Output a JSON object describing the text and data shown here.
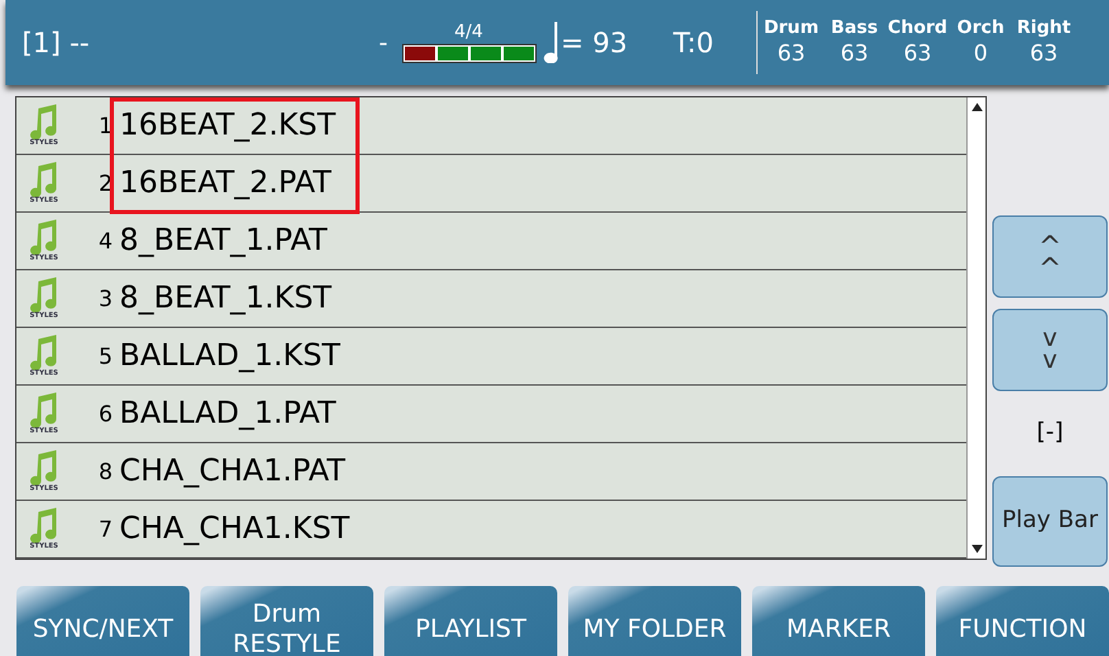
{
  "header": {
    "slot": "[1] --",
    "dash": "-",
    "time_signature": "4/4",
    "beats": [
      {
        "selected": true
      },
      {
        "selected": false
      },
      {
        "selected": false
      },
      {
        "selected": false
      }
    ],
    "tempo": "= 93",
    "transpose": "T:0",
    "volumes": [
      {
        "label": "Drum",
        "value": "63"
      },
      {
        "label": "Bass",
        "value": "63"
      },
      {
        "label": "Chord",
        "value": "63"
      },
      {
        "label": "Orch",
        "value": "0"
      },
      {
        "label": "Right",
        "value": "63"
      }
    ]
  },
  "files": [
    {
      "icon_label": "STYLES",
      "number": "1",
      "name": "16BEAT_2.KST",
      "highlighted": true
    },
    {
      "icon_label": "STYLES",
      "number": "2",
      "name": "16BEAT_2.PAT",
      "highlighted": true
    },
    {
      "icon_label": "STYLES",
      "number": "4",
      "name": "8_BEAT_1.PAT",
      "highlighted": false
    },
    {
      "icon_label": "STYLES",
      "number": "3",
      "name": "8_BEAT_1.KST",
      "highlighted": false
    },
    {
      "icon_label": "STYLES",
      "number": "5",
      "name": "BALLAD_1.KST",
      "highlighted": false
    },
    {
      "icon_label": "STYLES",
      "number": "6",
      "name": "BALLAD_1.PAT",
      "highlighted": false
    },
    {
      "icon_label": "STYLES",
      "number": "8",
      "name": "CHA_CHA1.PAT",
      "highlighted": false
    },
    {
      "icon_label": "STYLES",
      "number": "7",
      "name": "CHA_CHA1.KST",
      "highlighted": false
    }
  ],
  "side": {
    "up": "^\n^",
    "down": "v\nv",
    "status": "[-]",
    "play_bar": "Play Bar"
  },
  "buttons": [
    {
      "label": "SYNC/NEXT"
    },
    {
      "label": "Drum\nRESTYLE"
    },
    {
      "label": "PLAYLIST"
    },
    {
      "label": "MY FOLDER"
    },
    {
      "label": "MARKER"
    },
    {
      "label": "FUNCTION"
    }
  ]
}
